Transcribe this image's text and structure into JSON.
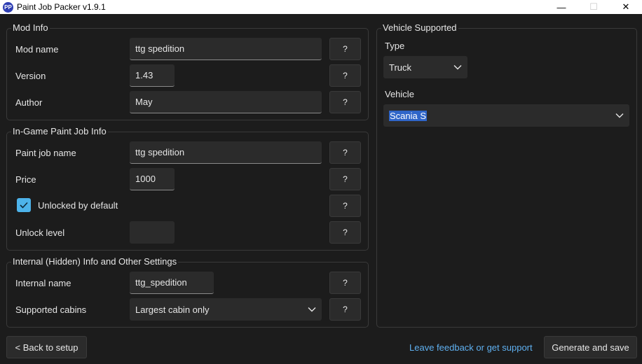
{
  "window": {
    "title": "Paint Job Packer v1.9.1",
    "icon_text": "PP",
    "minimize_glyph": "—",
    "maximize_glyph": "☐",
    "close_glyph": "✕"
  },
  "mod_info": {
    "title": "Mod Info",
    "mod_name_label": "Mod name",
    "mod_name_value": "ttg spedition",
    "version_label": "Version",
    "version_value": "1.43",
    "author_label": "Author",
    "author_value": "May"
  },
  "paint_job_info": {
    "title": "In-Game Paint Job Info",
    "paint_job_name_label": "Paint job name",
    "paint_job_name_value": "ttg spedition",
    "price_label": "Price",
    "price_value": "1000",
    "unlocked_label": "Unlocked by default",
    "unlocked_checked": true,
    "unlock_level_label": "Unlock level",
    "unlock_level_value": ""
  },
  "internal_info": {
    "title": "Internal (Hidden) Info and Other Settings",
    "internal_name_label": "Internal name",
    "internal_name_value": "ttg_spedition",
    "supported_cabins_label": "Supported cabins",
    "supported_cabins_value": "Largest cabin only"
  },
  "vehicle_supported": {
    "title": "Vehicle Supported",
    "type_label": "Type",
    "type_value": "Truck",
    "vehicle_label": "Vehicle",
    "vehicle_value": "Scania S"
  },
  "help_label": "?",
  "footer": {
    "back_label": "< Back to setup",
    "feedback_label": "Leave feedback or get support",
    "generate_label": "Generate and save"
  },
  "colors": {
    "background": "#1c1c1c",
    "field": "#2b2b2b",
    "accent": "#4db3ea",
    "link": "#5fb0f0",
    "selection": "#2f65c8"
  }
}
